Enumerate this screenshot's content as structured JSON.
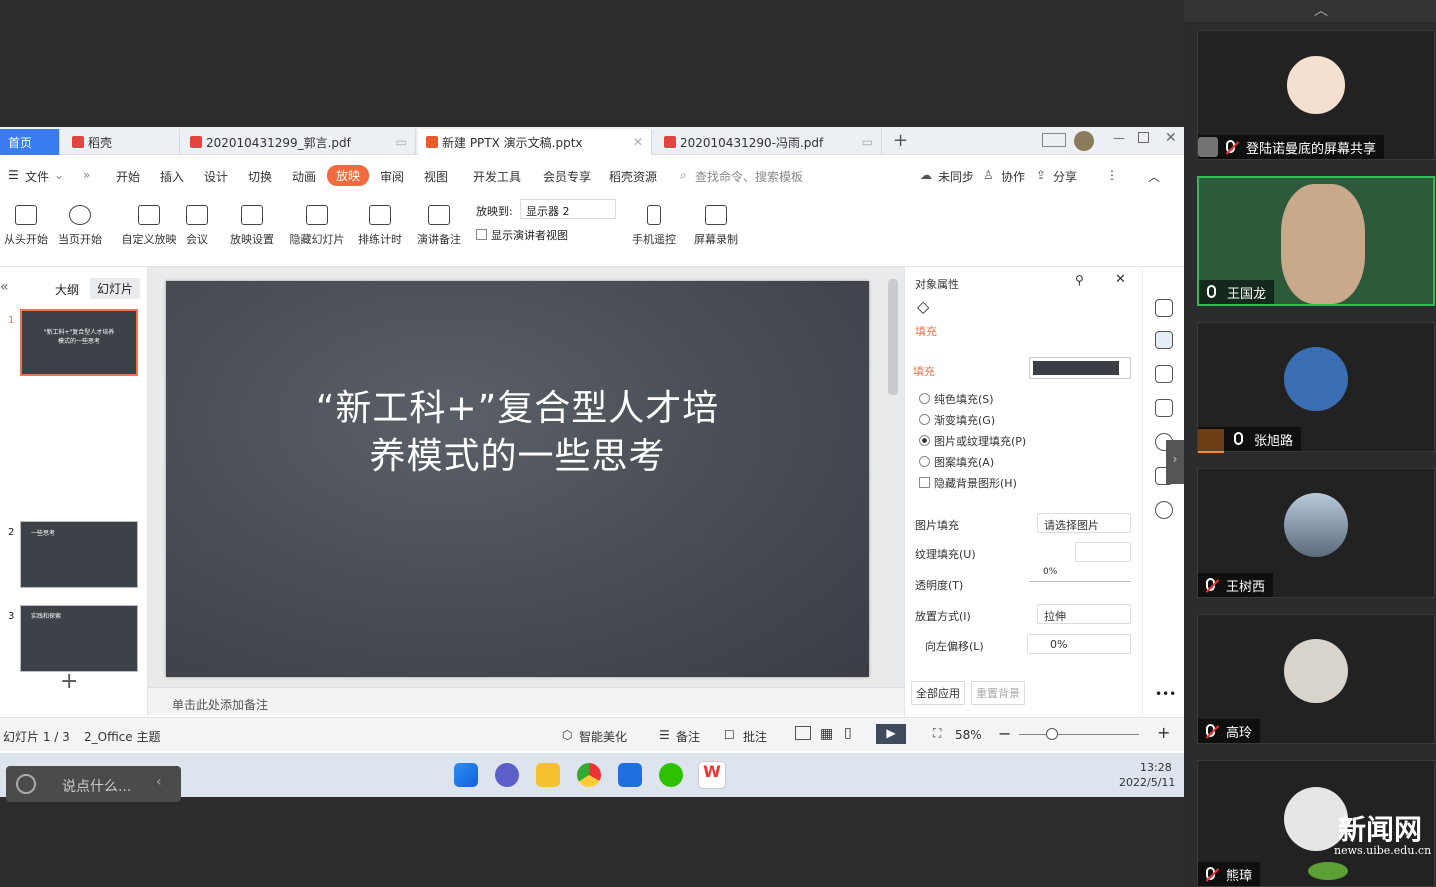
{
  "wps": {
    "tabs": [
      {
        "label": "首页"
      },
      {
        "label": "稻壳"
      },
      {
        "label": "202010431299_郭言.pdf"
      },
      {
        "label": "新建 PPTX 演示文稿.pptx"
      },
      {
        "label": "202010431290-冯雨.pdf"
      }
    ],
    "add_tab": "+",
    "menu": {
      "file": "文件",
      "items": [
        "开始",
        "插入",
        "设计",
        "切换",
        "动画",
        "放映",
        "审阅",
        "视图",
        "开发工具",
        "会员专享",
        "稻壳资源"
      ],
      "active": "放映",
      "search": "查找命令、搜索模板",
      "sync": "未同步",
      "collab": "协作",
      "share": "分享"
    },
    "ribbon": {
      "buttons": [
        "从头开始",
        "当页开始",
        "自定义放映",
        "会议",
        "放映设置",
        "隐藏幻灯片",
        "排练计时",
        "演讲备注",
        "手机遥控",
        "屏幕录制"
      ],
      "project_to_label": "放映到:",
      "project_to_value": "显示器 2",
      "presenter_view": "显示演讲者视图"
    },
    "left": {
      "outline_tab": "大纲",
      "slides_tab": "幻灯片",
      "slide_numbers": [
        "1",
        "2",
        "3"
      ],
      "thumb1": "\"新工科+\"复合型人才培养模式的一些思考",
      "thumb2_title": "一些思考",
      "thumb3_title": "实践和探索",
      "add": "+"
    },
    "slide": {
      "title_line1": "“新工科+”复合型人才培",
      "title_line2": "养模式的一些思考"
    },
    "notes": "单击此处添加备注",
    "prop": {
      "header": "对象属性",
      "tab": "填充",
      "section": "填充",
      "options": [
        "纯色填充(S)",
        "渐变填充(G)",
        "图片或纹理填充(P)",
        "图案填充(A)",
        "隐藏背景图形(H)"
      ],
      "selected": 2,
      "pic_fill_label": "图片填充",
      "pic_fill_value": "请选择图片",
      "texture_label": "纹理填充(U)",
      "transparency_label": "透明度(T)",
      "transparency_value": "0%",
      "place_label": "放置方式(I)",
      "place_value": "拉伸",
      "offset_label": "向左偏移(L)",
      "offset_value": "0%",
      "apply_all": "全部应用",
      "reset_bg": "重置背景"
    },
    "status": {
      "slide_info": "幻灯片 1 / 3",
      "theme": "2_Office 主题",
      "beautify": "智能美化",
      "notes": "备注",
      "comment": "批注",
      "zoom": "58%"
    }
  },
  "taskbar": {
    "time": "13:28",
    "date": "2022/5/11"
  },
  "comment_box": {
    "placeholder": "说点什么..."
  },
  "participants": [
    {
      "name": "登陆诺曼底的屏幕共享",
      "muted": true
    },
    {
      "name": "王国龙",
      "muted": false
    },
    {
      "name": "张旭路",
      "muted": false
    },
    {
      "name": "王树西",
      "muted": true
    },
    {
      "name": "高玲",
      "muted": true
    },
    {
      "name": "熊璋",
      "muted": true
    }
  ],
  "watermark": {
    "text": "新闻网",
    "url": "news.uibe.edu.cn"
  }
}
